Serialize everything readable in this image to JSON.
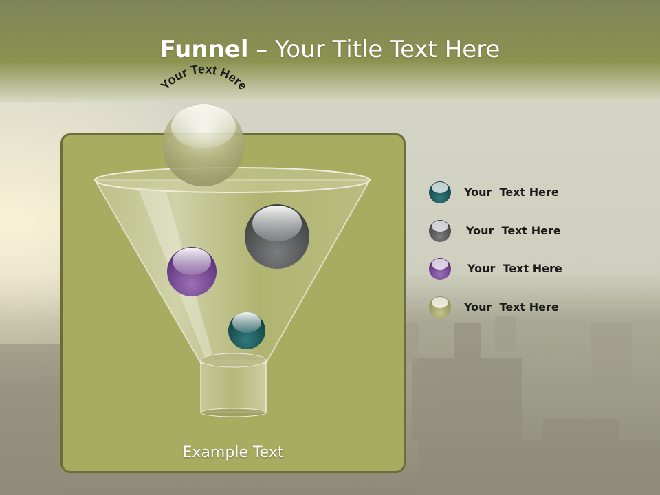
{
  "slide": {
    "title_strong": "Funnel",
    "title_rest": " – Your Title Text Here",
    "arc_text": "Your Text Here",
    "example_text": "Example Text"
  },
  "legend": [
    {
      "label": "Your  Text Here",
      "color": "#1f5a5c"
    },
    {
      "label": "Your  Text Here",
      "color": "#55575a"
    },
    {
      "label": "Your  Text Here",
      "color": "#6a3f88"
    },
    {
      "label": "Your  Text Here",
      "color": "#a6a86a"
    }
  ],
  "colors": {
    "panel": "#a8ac61",
    "panel_border": "#6b6d3a",
    "header_band": "#858d4c"
  }
}
